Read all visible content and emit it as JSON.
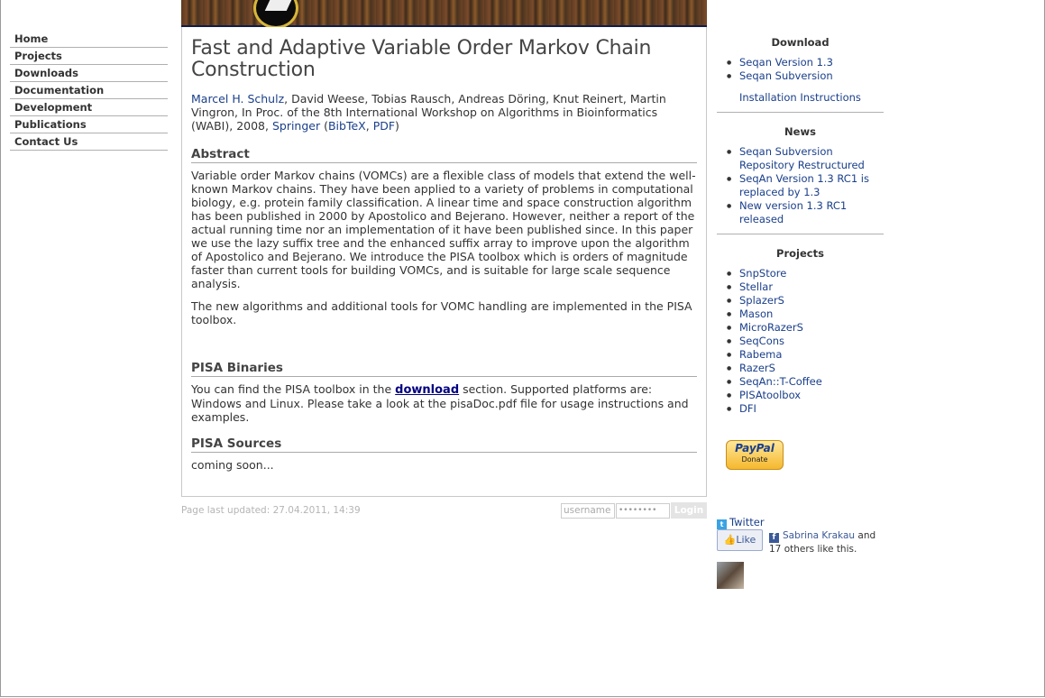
{
  "nav": {
    "items": [
      "Home",
      "Projects",
      "Downloads",
      "Documentation",
      "Development",
      "Publications",
      "Contact Us"
    ]
  },
  "article": {
    "title": "Fast and Adaptive Variable Order Markov Chain Construction",
    "authors": {
      "first_author": "Marcel H. Schulz",
      "rest": ", David Weese, Tobias Rausch, Andreas Döring, Knut Reinert, Martin Vingron, In Proc. of the 8th International Workshop on Algorithms in Bioinformatics (WABI), 2008, ",
      "springer": "Springer",
      "open_paren": " (",
      "bibtex": "BibTeX",
      "comma": ", ",
      "pdf": "PDF",
      "close_paren": ")"
    },
    "abstract_heading": "Abstract",
    "abstract_p1": "Variable order Markov chains (VOMCs) are a flexible class of models that extend the well-known Markov chains. They have been applied to a variety of problems in computational biology, e.g. protein family classification. A linear time and space construction algorithm has been published in 2000 by Apostolico and Bejerano. However, neither a report of the actual running time nor an implementation of it have been published since. In this paper we use the lazy suffix tree and the enhanced suffix array to improve upon the algorithm of Apostolico and Bejerano. We introduce the PISA toolbox which is orders of magnitude faster than current tools for building VOMCs, and is suitable for large scale sequence analysis.",
    "abstract_p2": "The new algorithms and additional tools for VOMC handling are implemented in the PISA toolbox.",
    "binaries_heading": "PISA Binaries",
    "binaries_pre": "You can find the PISA toolbox in the ",
    "binaries_link": "download",
    "binaries_post": " section. Supported platforms are: Windows and Linux. Please take a look at the pisaDoc.pdf file for usage instructions and examples.",
    "sources_heading": "PISA Sources",
    "sources_text": "coming soon..."
  },
  "footer": {
    "updated": "Page last updated: 27.04.2011, 14:39",
    "username_placeholder": "username",
    "password_value": "••••••••",
    "login_label": "Login"
  },
  "sidebar": {
    "download": {
      "heading": "Download",
      "items": [
        "Seqan Version 1.3",
        "Seqan Subversion"
      ],
      "extra": "Installation Instructions"
    },
    "news": {
      "heading": "News",
      "items": [
        "Seqan Subversion Repository Restructured",
        "SeqAn Version 1.3 RC1 is replaced by 1.3",
        "New version 1.3 RC1 released"
      ]
    },
    "projects": {
      "heading": "Projects",
      "items": [
        "SnpStore",
        "Stellar",
        "SplazerS",
        "Mason",
        "MicroRazerS",
        "SeqCons",
        "Rabema",
        "RazerS",
        "SeqAn::T-Coffee",
        "PISAtoolbox",
        "DFI"
      ]
    },
    "paypal": {
      "brand": "PayPal",
      "label": "Donate"
    },
    "twitter": {
      "label": "Twitter",
      "icon": "twitter-icon"
    },
    "facebook": {
      "like_label": "Like",
      "name": "Sabrina Krakau",
      "rest": " and 17 others like this."
    }
  }
}
